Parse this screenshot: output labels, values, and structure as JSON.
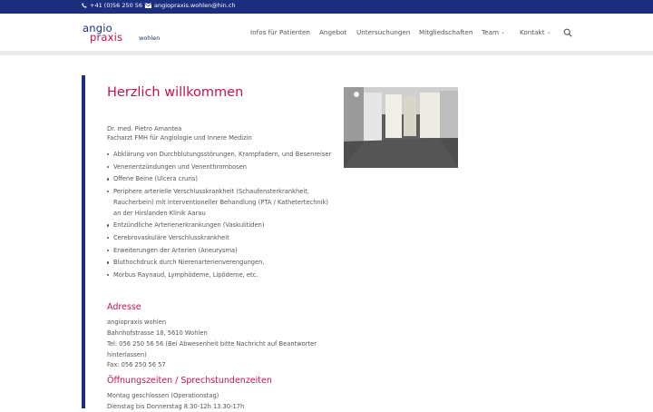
{
  "topbar": {
    "phone": "+41 (0)56 250 56 56",
    "email": "angiopraxis.wohlen@hin.ch",
    "phone_icon": "phone-icon",
    "email_icon": "envelope-icon"
  },
  "logo": {
    "line1": "angio",
    "line2": "praxis",
    "line3": "wohlen"
  },
  "nav": {
    "items": [
      {
        "label": "Infos für Patienten"
      },
      {
        "label": "Angebot"
      },
      {
        "label": "Untersuchungen"
      },
      {
        "label": "Mitgliedschaften"
      },
      {
        "label": "Team"
      },
      {
        "label": "Kontakt"
      }
    ],
    "search_icon": "search-icon"
  },
  "main": {
    "title": "Herzlich willkommen",
    "doctor_name": "Dr. med. Pietro Amantea",
    "doctor_title": "Facharzt FMH für Angiologie und Innere Medizin",
    "services": [
      "Abklärung von Durchblutungsstörungen, Krampfadern, und Besenreiser",
      "Venenentzündungen und Venenthrombosen",
      "Offene Beine (Ulcera cruris)",
      "Periphere arterielle Verschlusskrankheit (Schaufensterkrankheit, Raucherbein) mit interventioneller Behandlung (PTA / Kathetertechnik) an der Hirslanden Klinik Aarau",
      "Entzündliche Arterienerkrankungen (Vaskulitiden)",
      "Cerebrovaskuläre Verschlusskrankheit",
      "Erweiterungen der Arterien (Aneurysma)",
      "Bluthochdruck durch Nierenarterienverengungen,",
      "Morbus Raynaud, Lymphödeme, Lipödeme, etc."
    ],
    "address_heading": "Adresse",
    "address": {
      "name": "angiopraxis wohlen",
      "street": "Bahnhofstrasse 18, 5610 Wohlen",
      "tel": "Tel: 056 250 56 56 (Bei Abwesenheit bitte Nachricht auf Beantworter hinterlassen)",
      "fax": "Fax: 056 250 56 57"
    },
    "hours_heading": "Öffnungszeiten / Sprechstundenzeiten",
    "hours": [
      "Montag geschlossen (Operationstag)",
      "Dienstag bis Donnerstag 8.30-12h 13.30-17h"
    ]
  }
}
